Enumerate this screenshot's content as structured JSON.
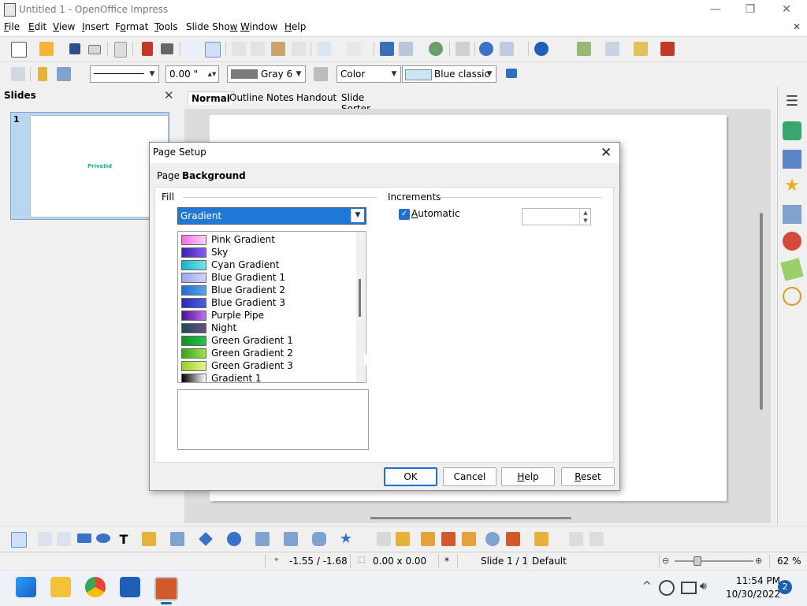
{
  "window": {
    "title": "Untitled 1 - OpenOffice Impress",
    "minimize": "—",
    "restore": "❐",
    "close": "✕",
    "doc_close": "✕"
  },
  "menu": [
    {
      "pre": "",
      "u": "F",
      "post": "ile"
    },
    {
      "pre": "",
      "u": "E",
      "post": "dit"
    },
    {
      "pre": "",
      "u": "V",
      "post": "iew"
    },
    {
      "pre": "",
      "u": "I",
      "post": "nsert"
    },
    {
      "pre": "F",
      "u": "o",
      "post": "rmat"
    },
    {
      "pre": "",
      "u": "T",
      "post": "ools"
    },
    {
      "pre": "Slide Sho",
      "u": "w",
      "post": ""
    },
    {
      "pre": "",
      "u": "W",
      "post": "indow"
    },
    {
      "pre": "",
      "u": "H",
      "post": "elp"
    }
  ],
  "format_bar": {
    "line_width": "0.00 \"",
    "line_color": "Gray 6",
    "area_style": "Color",
    "area_color": "Blue classic"
  },
  "slides_pane": {
    "title": "Slides",
    "close": "✕",
    "thumb_number": "1",
    "thumb_text": "Privetid"
  },
  "view_tabs": [
    "Normal",
    "Outline",
    "Notes",
    "Handout",
    "Slide Sorter"
  ],
  "dialog": {
    "title": "Page Setup",
    "close": "✕",
    "tabs": [
      "Page",
      "Background"
    ],
    "fill_label": "Fill",
    "fill_value": "Gradient",
    "increments_label": "Increments",
    "automatic_label": "Automatic",
    "automatic_checked": "✓",
    "gradients": [
      {
        "name": "Pink Gradient",
        "c1": "#f36ce6",
        "c2": "#fbd3f6"
      },
      {
        "name": "Sky",
        "c1": "#3a1fb8",
        "c2": "#8a5cf0"
      },
      {
        "name": "Cyan Gradient",
        "c1": "#10b7c7",
        "c2": "#7be3ea"
      },
      {
        "name": "Blue Gradient 1",
        "c1": "#9da6f0",
        "c2": "#d0d5fb"
      },
      {
        "name": "Blue Gradient 2",
        "c1": "#1d6fcf",
        "c2": "#5aa2ea"
      },
      {
        "name": "Blue Gradient 3",
        "c1": "#2a2ab8",
        "c2": "#4f5fe0"
      },
      {
        "name": "Purple Pipe",
        "c1": "#4a1090",
        "c2": "#c26ef2"
      },
      {
        "name": "Night",
        "c1": "#1c4d5b",
        "c2": "#6a4c86"
      },
      {
        "name": "Green Gradient 1",
        "c1": "#0e8e25",
        "c2": "#2ac24b"
      },
      {
        "name": "Green Gradient 2",
        "c1": "#3aa51a",
        "c2": "#9ee24b"
      },
      {
        "name": "Green Gradient 3",
        "c1": "#98cf24",
        "c2": "#e5f792"
      },
      {
        "name": "Gradient 1",
        "c1": "#000000",
        "c2": "#ffffff"
      }
    ],
    "buttons": {
      "ok": "OK",
      "cancel": "Cancel",
      "help": "Help",
      "reset": "Reset"
    }
  },
  "status": {
    "position": "-1.55 / -1.68",
    "size": "0.00 x 0.00",
    "modified": "*",
    "slide": "Slide 1 / 1",
    "layout": "Default",
    "zoom": "62 %"
  },
  "taskbar": {
    "time": "11:54 PM",
    "date": "10/30/2022",
    "notifications": "2"
  },
  "colors": {
    "accent": "#1f78d6",
    "selection": "#b8d6ef"
  }
}
